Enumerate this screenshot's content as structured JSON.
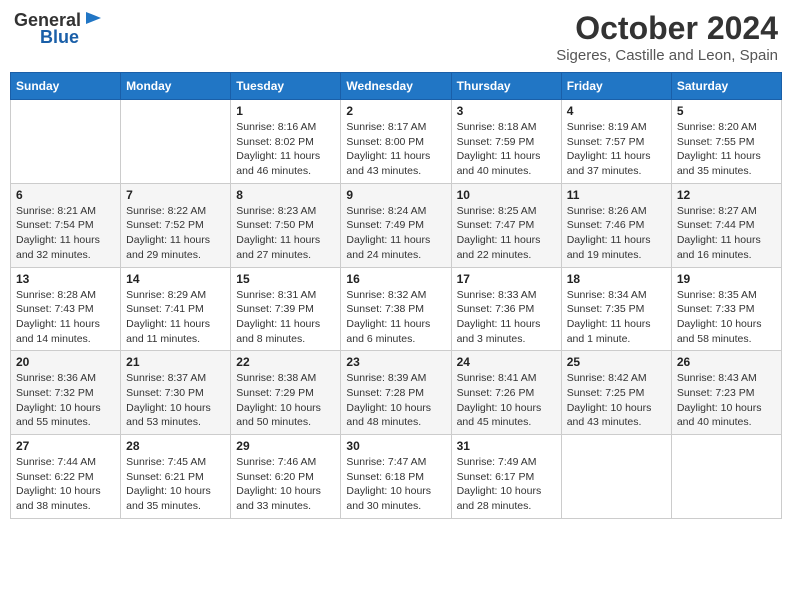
{
  "header": {
    "logo": {
      "text_general": "General",
      "text_blue": "Blue",
      "icon_desc": "flag-icon"
    },
    "title": "October 2024",
    "subtitle": "Sigeres, Castille and Leon, Spain"
  },
  "weekdays": [
    "Sunday",
    "Monday",
    "Tuesday",
    "Wednesday",
    "Thursday",
    "Friday",
    "Saturday"
  ],
  "weeks": [
    {
      "days": [
        {
          "number": "",
          "info": ""
        },
        {
          "number": "",
          "info": ""
        },
        {
          "number": "1",
          "info": "Sunrise: 8:16 AM\nSunset: 8:02 PM\nDaylight: 11 hours and 46 minutes."
        },
        {
          "number": "2",
          "info": "Sunrise: 8:17 AM\nSunset: 8:00 PM\nDaylight: 11 hours and 43 minutes."
        },
        {
          "number": "3",
          "info": "Sunrise: 8:18 AM\nSunset: 7:59 PM\nDaylight: 11 hours and 40 minutes."
        },
        {
          "number": "4",
          "info": "Sunrise: 8:19 AM\nSunset: 7:57 PM\nDaylight: 11 hours and 37 minutes."
        },
        {
          "number": "5",
          "info": "Sunrise: 8:20 AM\nSunset: 7:55 PM\nDaylight: 11 hours and 35 minutes."
        }
      ]
    },
    {
      "days": [
        {
          "number": "6",
          "info": "Sunrise: 8:21 AM\nSunset: 7:54 PM\nDaylight: 11 hours and 32 minutes."
        },
        {
          "number": "7",
          "info": "Sunrise: 8:22 AM\nSunset: 7:52 PM\nDaylight: 11 hours and 29 minutes."
        },
        {
          "number": "8",
          "info": "Sunrise: 8:23 AM\nSunset: 7:50 PM\nDaylight: 11 hours and 27 minutes."
        },
        {
          "number": "9",
          "info": "Sunrise: 8:24 AM\nSunset: 7:49 PM\nDaylight: 11 hours and 24 minutes."
        },
        {
          "number": "10",
          "info": "Sunrise: 8:25 AM\nSunset: 7:47 PM\nDaylight: 11 hours and 22 minutes."
        },
        {
          "number": "11",
          "info": "Sunrise: 8:26 AM\nSunset: 7:46 PM\nDaylight: 11 hours and 19 minutes."
        },
        {
          "number": "12",
          "info": "Sunrise: 8:27 AM\nSunset: 7:44 PM\nDaylight: 11 hours and 16 minutes."
        }
      ]
    },
    {
      "days": [
        {
          "number": "13",
          "info": "Sunrise: 8:28 AM\nSunset: 7:43 PM\nDaylight: 11 hours and 14 minutes."
        },
        {
          "number": "14",
          "info": "Sunrise: 8:29 AM\nSunset: 7:41 PM\nDaylight: 11 hours and 11 minutes."
        },
        {
          "number": "15",
          "info": "Sunrise: 8:31 AM\nSunset: 7:39 PM\nDaylight: 11 hours and 8 minutes."
        },
        {
          "number": "16",
          "info": "Sunrise: 8:32 AM\nSunset: 7:38 PM\nDaylight: 11 hours and 6 minutes."
        },
        {
          "number": "17",
          "info": "Sunrise: 8:33 AM\nSunset: 7:36 PM\nDaylight: 11 hours and 3 minutes."
        },
        {
          "number": "18",
          "info": "Sunrise: 8:34 AM\nSunset: 7:35 PM\nDaylight: 11 hours and 1 minute."
        },
        {
          "number": "19",
          "info": "Sunrise: 8:35 AM\nSunset: 7:33 PM\nDaylight: 10 hours and 58 minutes."
        }
      ]
    },
    {
      "days": [
        {
          "number": "20",
          "info": "Sunrise: 8:36 AM\nSunset: 7:32 PM\nDaylight: 10 hours and 55 minutes."
        },
        {
          "number": "21",
          "info": "Sunrise: 8:37 AM\nSunset: 7:30 PM\nDaylight: 10 hours and 53 minutes."
        },
        {
          "number": "22",
          "info": "Sunrise: 8:38 AM\nSunset: 7:29 PM\nDaylight: 10 hours and 50 minutes."
        },
        {
          "number": "23",
          "info": "Sunrise: 8:39 AM\nSunset: 7:28 PM\nDaylight: 10 hours and 48 minutes."
        },
        {
          "number": "24",
          "info": "Sunrise: 8:41 AM\nSunset: 7:26 PM\nDaylight: 10 hours and 45 minutes."
        },
        {
          "number": "25",
          "info": "Sunrise: 8:42 AM\nSunset: 7:25 PM\nDaylight: 10 hours and 43 minutes."
        },
        {
          "number": "26",
          "info": "Sunrise: 8:43 AM\nSunset: 7:23 PM\nDaylight: 10 hours and 40 minutes."
        }
      ]
    },
    {
      "days": [
        {
          "number": "27",
          "info": "Sunrise: 7:44 AM\nSunset: 6:22 PM\nDaylight: 10 hours and 38 minutes."
        },
        {
          "number": "28",
          "info": "Sunrise: 7:45 AM\nSunset: 6:21 PM\nDaylight: 10 hours and 35 minutes."
        },
        {
          "number": "29",
          "info": "Sunrise: 7:46 AM\nSunset: 6:20 PM\nDaylight: 10 hours and 33 minutes."
        },
        {
          "number": "30",
          "info": "Sunrise: 7:47 AM\nSunset: 6:18 PM\nDaylight: 10 hours and 30 minutes."
        },
        {
          "number": "31",
          "info": "Sunrise: 7:49 AM\nSunset: 6:17 PM\nDaylight: 10 hours and 28 minutes."
        },
        {
          "number": "",
          "info": ""
        },
        {
          "number": "",
          "info": ""
        }
      ]
    }
  ]
}
